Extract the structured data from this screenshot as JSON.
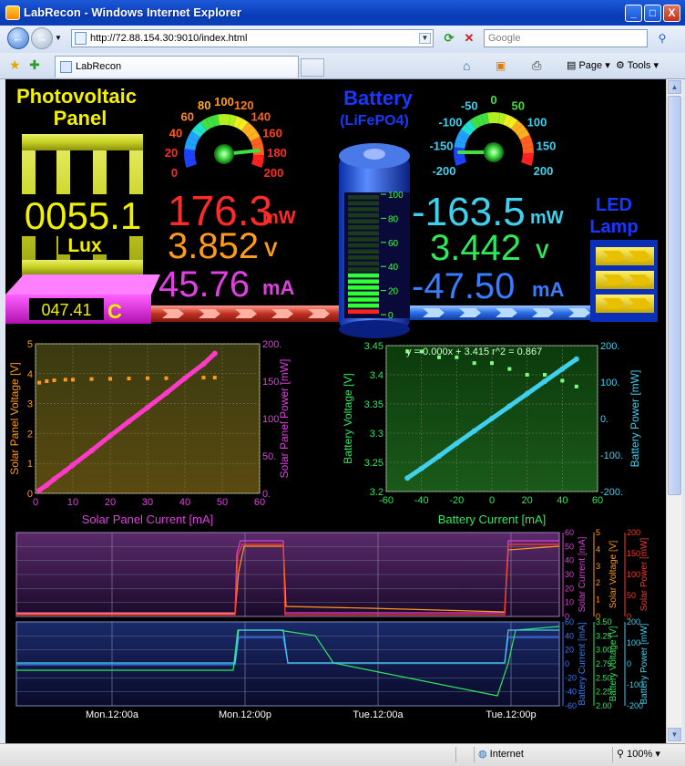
{
  "window": {
    "title": "LabRecon - Windows Internet Explorer",
    "minimize_glyph": "_",
    "maximize_glyph": "□",
    "close_glyph": "X"
  },
  "nav": {
    "url": "http://72.88.154.30:9010/index.html",
    "search_placeholder": "Google",
    "back_glyph": "←",
    "forward_glyph": "→",
    "refresh_glyph": "⟳",
    "stop_glyph": "✕",
    "search_glyph": "⚲"
  },
  "tabs": [
    {
      "label": "LabRecon"
    }
  ],
  "toolbar": {
    "page_label": "Page",
    "tools_label": "Tools"
  },
  "status": {
    "zone": "Internet",
    "zoom": "100%"
  },
  "dashboard": {
    "pv": {
      "title_line1": "Photovoltaic",
      "title_line2": "Panel",
      "lux_value": "0055.1",
      "lux_unit": "Lux",
      "temp_value": "047.41",
      "temp_unit": "C",
      "power_value": "176.3",
      "power_unit": "mW",
      "voltage_value": "3.852",
      "voltage_unit": "V",
      "current_value": "45.76",
      "current_unit": "mA",
      "gauge_ticks": [
        "0",
        "20",
        "40",
        "60",
        "80",
        "100",
        "120",
        "140",
        "160",
        "180",
        "200"
      ],
      "gauge_value": 176.3
    },
    "battery": {
      "title_line1": "Battery",
      "title_line2": "(LiFePO4)",
      "scale_labels": [
        "100",
        "80",
        "60",
        "40",
        "20",
        "0"
      ],
      "charge_percent": 35,
      "power_value": "-163.5",
      "power_unit": "mW",
      "voltage_value": "3.442",
      "voltage_unit": "V",
      "current_value": "-47.50",
      "current_unit": "mA",
      "gauge_ticks": [
        "-200",
        "-150",
        "-100",
        "-50",
        "0",
        "50",
        "100",
        "150",
        "200"
      ],
      "gauge_value": -163.5
    },
    "led": {
      "title_line1": "LED",
      "title_line2": "Lamp"
    }
  },
  "chart_data": [
    {
      "type": "scatter",
      "xlabel": "Solar Panel Current [mA]",
      "ylabel": "Solar Panel Voltage [V]",
      "y2label": "Solar Panel Power [mW]",
      "xlim": [
        0,
        60
      ],
      "ylim": [
        0,
        5
      ],
      "y2lim": [
        0,
        200
      ],
      "x_ticks": [
        "0",
        "10",
        "20",
        "30",
        "40",
        "50",
        "60"
      ],
      "y_ticks": [
        "0",
        "1",
        "2",
        "3",
        "4",
        "5"
      ],
      "y2_ticks": [
        "0.",
        "50.",
        "100.",
        "150.",
        "200."
      ],
      "grid": true,
      "series": [],
      "voltage_points": {
        "x": [
          1,
          3,
          5,
          8,
          10,
          15,
          20,
          25,
          30,
          35,
          40,
          45,
          48
        ],
        "y": [
          3.7,
          3.75,
          3.78,
          3.8,
          3.8,
          3.82,
          3.83,
          3.84,
          3.85,
          3.85,
          3.86,
          3.87,
          3.87
        ]
      },
      "power_points": {
        "x": [
          1,
          3,
          5,
          8,
          10,
          15,
          20,
          25,
          30,
          35,
          40,
          45,
          48
        ],
        "y": [
          4,
          11,
          19,
          30,
          38,
          57,
          77,
          96,
          115,
          134,
          154,
          173,
          187
        ]
      }
    },
    {
      "type": "scatter",
      "xlabel": "Battery Current [mA]",
      "ylabel": "Battery Voltage [V]",
      "y2label": "Battery Power [mW]",
      "annotation": "y = 0.000x + 3.415    r^2 = 0.867",
      "xlim": [
        -60,
        60
      ],
      "ylim": [
        3.2,
        3.45
      ],
      "y2lim": [
        -200,
        200
      ],
      "x_ticks": [
        "-60",
        "-40",
        "-20",
        "0",
        "20",
        "40",
        "60"
      ],
      "y_ticks": [
        "3.2",
        "3.25",
        "3.3",
        "3.35",
        "3.4",
        "3.45"
      ],
      "y2_ticks": [
        "-200.",
        "-100.",
        "0.",
        "100.",
        "200."
      ],
      "grid": true,
      "series": [],
      "voltage_points": {
        "x": [
          -48,
          -40,
          -30,
          -20,
          -10,
          0,
          10,
          20,
          30,
          40,
          48
        ],
        "y": [
          3.44,
          3.44,
          3.43,
          3.43,
          3.42,
          3.42,
          3.41,
          3.4,
          3.4,
          3.39,
          3.38
        ]
      },
      "power_points": {
        "x": [
          -48,
          -40,
          -30,
          -20,
          -10,
          0,
          10,
          20,
          30,
          40,
          48
        ],
        "y": [
          -163,
          -137,
          -103,
          -68,
          -34,
          0,
          34,
          68,
          102,
          136,
          163
        ]
      }
    },
    {
      "type": "line",
      "x_ticks": [
        "Mon.12:00a",
        "Mon.12:00p",
        "Tue.12:00a",
        "Tue.12:00p"
      ],
      "y_axes": [
        {
          "label": "Solar Current [mA]",
          "ticks": [
            "0",
            "10",
            "20",
            "30",
            "40",
            "50",
            "60"
          ]
        },
        {
          "label": "Solar Voltage [V]",
          "ticks": [
            "0",
            "1",
            "2",
            "3",
            "4",
            "5"
          ]
        },
        {
          "label": "Solar Power [mW]",
          "ticks": [
            "0",
            "50",
            "100",
            "150",
            "200"
          ]
        }
      ],
      "grid": true,
      "series": []
    },
    {
      "type": "line",
      "x_ticks": [
        "Mon.12:00a",
        "Mon.12:00p",
        "Tue.12:00a",
        "Tue.12:00p"
      ],
      "y_axes": [
        {
          "label": "Battery Current [mA]",
          "ticks": [
            "-60",
            "-40",
            "-20",
            "0",
            "20",
            "40",
            "60"
          ]
        },
        {
          "label": "Battery Voltage [V]",
          "ticks": [
            "2.00",
            "2.25",
            "2.50",
            "2.75",
            "3.00",
            "3.25",
            "3.50"
          ]
        },
        {
          "label": "Battery Power [mW]",
          "ticks": [
            "-200",
            "-100",
            "0",
            "100",
            "200"
          ]
        }
      ],
      "grid": true,
      "series": []
    }
  ],
  "colors": {
    "pv_power": "#ff2a2a",
    "pv_voltage": "#ff9a1a",
    "pv_current": "#e040e0",
    "bat_power": "#3fd0ee",
    "bat_voltage": "#2ee85a",
    "bat_current": "#3a7cff",
    "title_yellow": "#f4f000",
    "title_blue": "#1838ff"
  }
}
